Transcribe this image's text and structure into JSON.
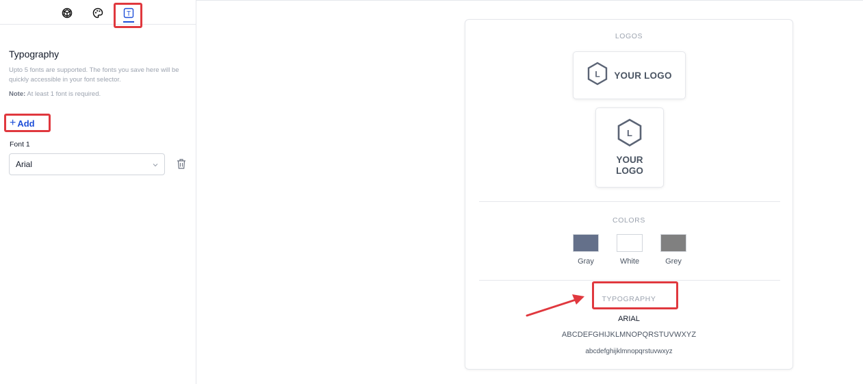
{
  "tabs": [
    {
      "icon": "cube-icon"
    },
    {
      "icon": "palette-icon"
    },
    {
      "icon": "text-icon",
      "glyph": "T",
      "active": true
    }
  ],
  "typography_panel": {
    "title": "Typography",
    "description": "Upto 5 fonts are supported. The fonts you save here will be quickly accessible in your font selector.",
    "note_label": "Note:",
    "note_text": " At least 1 font is required.",
    "add_plus": "+",
    "add_label": "Add",
    "fonts": [
      {
        "label": "Font 1",
        "value": "Arial"
      }
    ]
  },
  "preview": {
    "logos_heading": "LOGOS",
    "logo_text": "YOUR LOGO",
    "logo_text_line1": "YOUR",
    "logo_text_line2": "LOGO",
    "logo_letter": "L",
    "colors_heading": "COLORS",
    "colors": [
      {
        "name": "Gray",
        "hex": "#64708a"
      },
      {
        "name": "White",
        "hex": "#ffffff"
      },
      {
        "name": "Grey",
        "hex": "#808080"
      }
    ],
    "typography_heading": "TYPOGRAPHY",
    "font_name": "ARIAL",
    "uppercase_sample": "ABCDEFGHIJKLMNOPQRSTUVWXYZ",
    "lowercase_sample": "abcdefghijklmnopqrstuvwxyz"
  },
  "theme": {
    "accent": "#1d4ed8",
    "highlight": "#e0383e",
    "logo_stroke": "#5b6475"
  }
}
